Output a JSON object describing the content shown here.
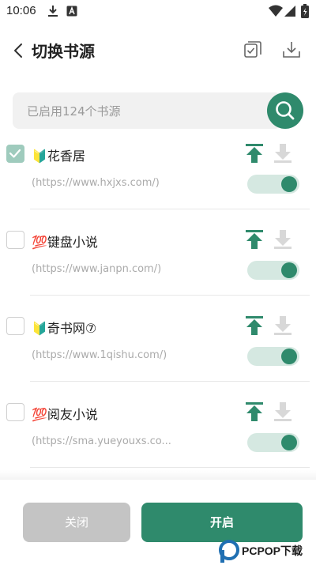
{
  "status_bar": {
    "time": "10:06"
  },
  "header": {
    "title": "切换书源"
  },
  "search": {
    "placeholder": "已启用124个书源"
  },
  "sources": [
    {
      "name": "🔰花香居",
      "url": "(https://www.hxjxs.com/)",
      "checked": true,
      "enabled": true
    },
    {
      "name": "💯键盘小说",
      "url": "(https://www.janpn.com/)",
      "checked": false,
      "enabled": true
    },
    {
      "name": "🔰奇书网⑦",
      "url": "(https://www.1qishu.com/)",
      "checked": false,
      "enabled": true
    },
    {
      "name": "💯阅友小说",
      "url": "(https://sma.yueyouxs.co...",
      "checked": false,
      "enabled": true
    }
  ],
  "footer": {
    "close_label": "关闭",
    "open_label": "开启"
  },
  "watermark": {
    "text": "PCPOP下载"
  },
  "colors": {
    "accent": "#2f8a6c",
    "toggle_track": "#d5e8e1",
    "checkbox_checked": "#9fcbbd",
    "close_button": "#c4c4c4"
  },
  "icons": [
    "back-arrow-icon",
    "select-all-icon",
    "import-icon",
    "search-icon",
    "pin-to-top-icon",
    "pin-to-bottom-icon",
    "download-status-icon",
    "a-status-icon",
    "wifi-icon",
    "signal-icon",
    "battery-icon"
  ]
}
